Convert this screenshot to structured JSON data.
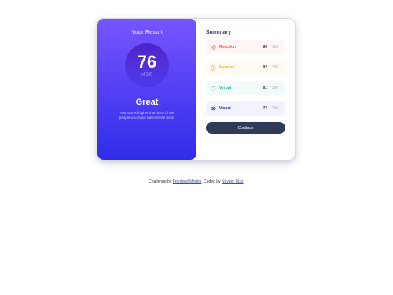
{
  "result": {
    "title": "Your Result",
    "score": "76",
    "score_of": "of 100",
    "rating": "Great",
    "description": "You scored higher than 65% of the people who have taken these tests."
  },
  "summary": {
    "title": "Summary",
    "items": [
      {
        "label": "Reaction",
        "score": "80",
        "max": "/ 100",
        "color": "#ff5757",
        "bg": "#fff6f5",
        "icon": "lightning-icon"
      },
      {
        "label": "Memory",
        "score": "92",
        "max": "/ 100",
        "color": "#ffb01f",
        "bg": "#fffbf2",
        "icon": "brain-icon"
      },
      {
        "label": "Verbal",
        "score": "61",
        "max": "/ 100",
        "color": "#00bb8f",
        "bg": "#f2fbfa",
        "icon": "chat-icon"
      },
      {
        "label": "Visual",
        "score": "72",
        "max": "/ 100",
        "color": "#1125d6",
        "bg": "#f3f3fd",
        "icon": "eye-icon"
      }
    ],
    "button": "Continue"
  },
  "footer": {
    "prefix": "Challenge by ",
    "link1": "Frontend Mentor",
    "middle": ". Coded by ",
    "link2": "Naveer Riaz",
    "suffix": "."
  }
}
